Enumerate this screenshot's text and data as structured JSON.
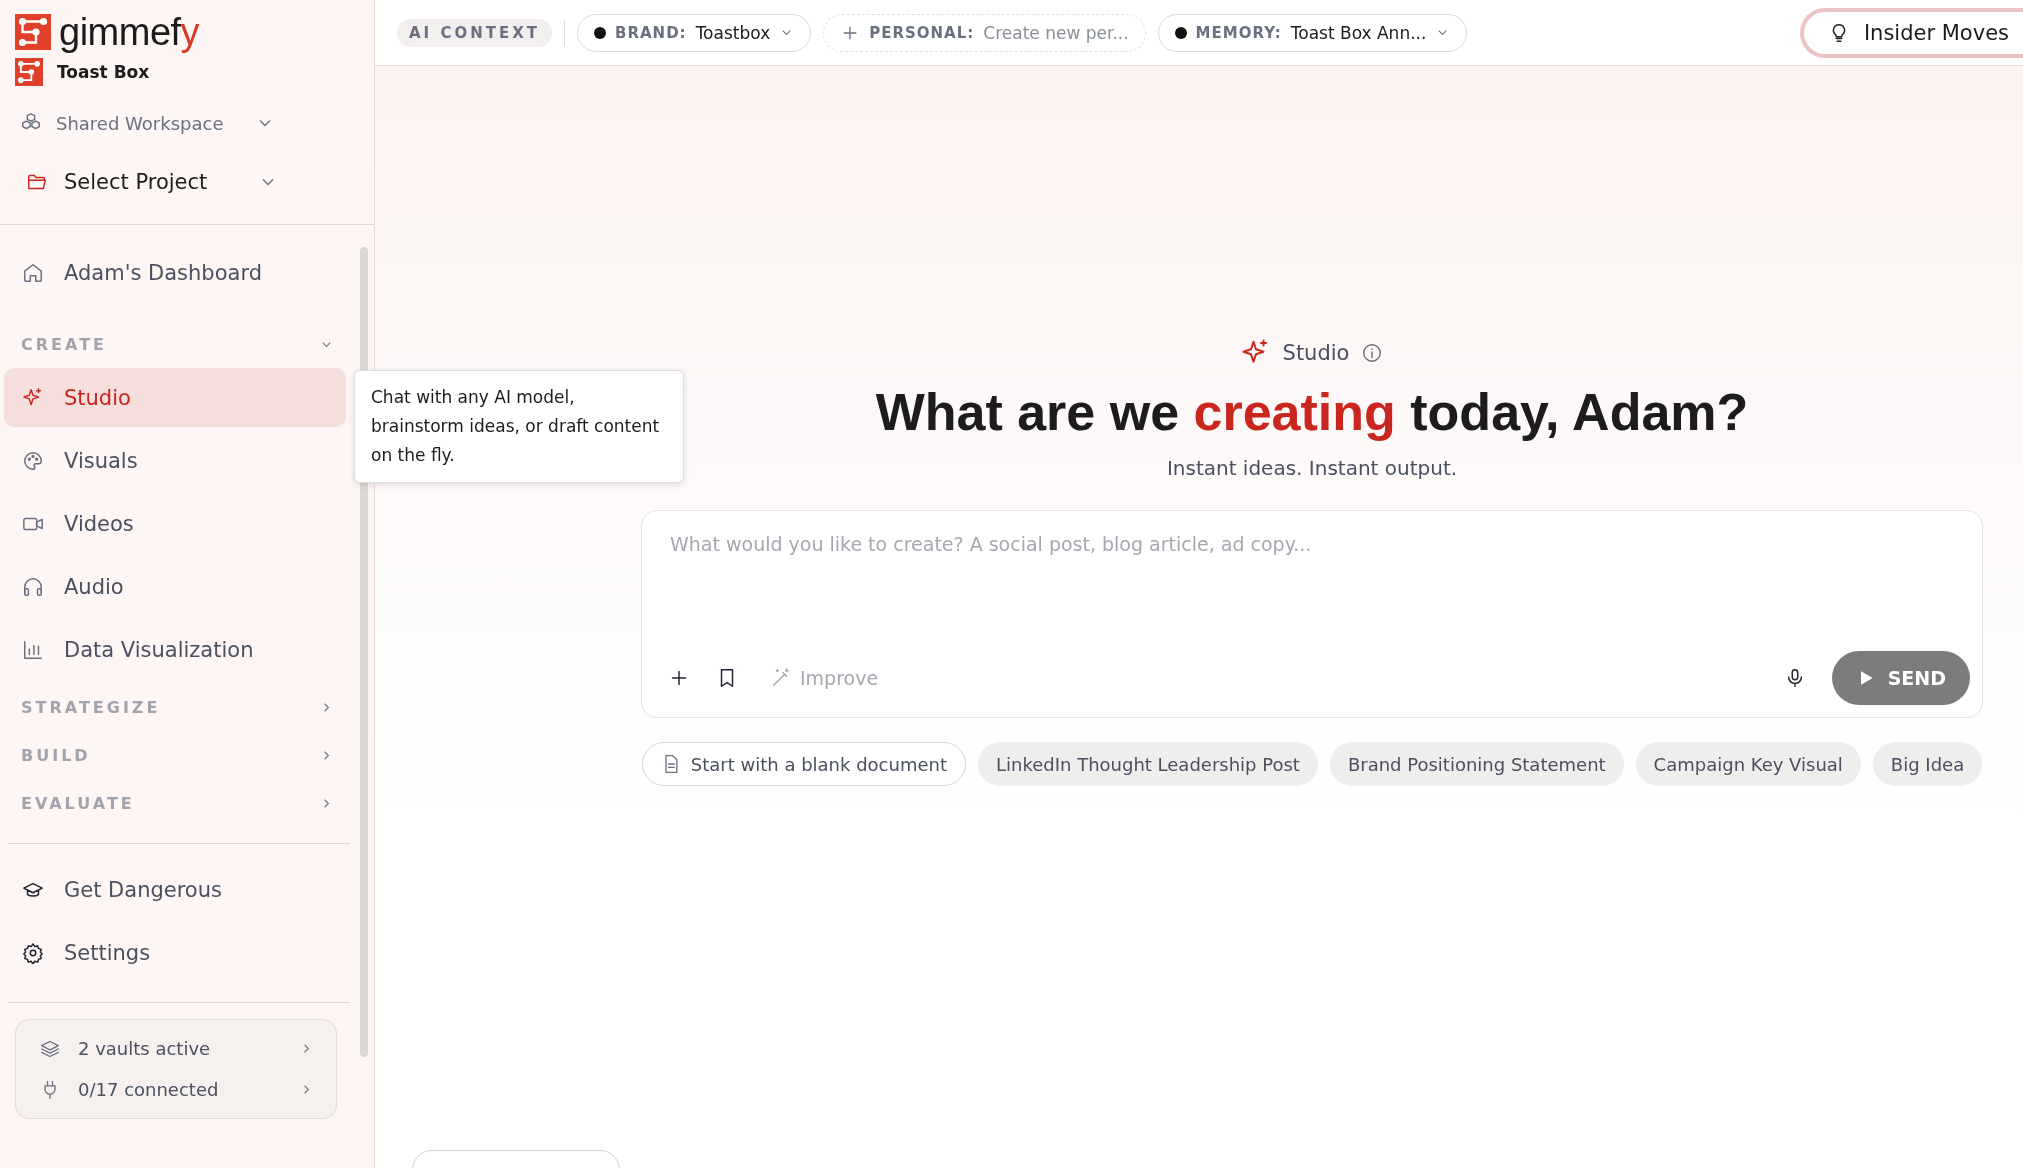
{
  "sidebar": {
    "logo": "gimmefy",
    "brand": "Toast Box",
    "workspace": "Shared Workspace",
    "project": "Select Project",
    "nav": [
      {
        "kind": "item",
        "label": "Adam's Dashboard",
        "selected": false
      },
      {
        "kind": "section",
        "label": "CREATE",
        "expanded": true
      },
      {
        "kind": "item",
        "label": "Studio",
        "selected": true
      },
      {
        "kind": "item",
        "label": "Visuals",
        "selected": false
      },
      {
        "kind": "item",
        "label": "Videos",
        "selected": false
      },
      {
        "kind": "item",
        "label": "Audio",
        "selected": false
      },
      {
        "kind": "item",
        "label": "Data Visualization",
        "selected": false
      },
      {
        "kind": "section",
        "label": "STRATEGIZE",
        "expanded": false
      },
      {
        "kind": "section",
        "label": "BUILD",
        "expanded": false
      },
      {
        "kind": "section",
        "label": "EVALUATE",
        "expanded": false
      }
    ],
    "footer_nav": [
      {
        "label": "Get Dangerous"
      },
      {
        "label": "Settings"
      }
    ],
    "status": [
      {
        "label": "2 vaults active"
      },
      {
        "label": "0/17 connected"
      }
    ]
  },
  "tooltip": "Chat with any AI model, brainstorm ideas, or draft content on the fly.",
  "top_bar": {
    "label": "AI CONTEXT",
    "pills": [
      {
        "kind": "dot",
        "key": "BRAND:",
        "value": "Toastbox"
      },
      {
        "kind": "add",
        "key": "PERSONAL:",
        "value": "Create new per..."
      },
      {
        "kind": "dot",
        "key": "MEMORY:",
        "value": "Toast Box Ann..."
      }
    ],
    "button": "Insider Moves"
  },
  "main": {
    "tag": "Studio",
    "heading": "What are we *creating* today, Adam?",
    "subtitle": "Instant ideas. Instant output.",
    "composer": {
      "placeholder": "What would you like to create? A social post, blog article, ad copy...",
      "improve": "Improve",
      "send": "SEND"
    },
    "suggestions": [
      {
        "kind": "outline",
        "label": "Start with a blank document"
      },
      {
        "kind": "chip",
        "label": "LinkedIn Thought Leadership Post"
      },
      {
        "kind": "chip",
        "label": "Brand Positioning Statement"
      },
      {
        "kind": "chip",
        "label": "Campaign Key Visual"
      },
      {
        "kind": "chip",
        "label": "Big Idea"
      }
    ]
  }
}
